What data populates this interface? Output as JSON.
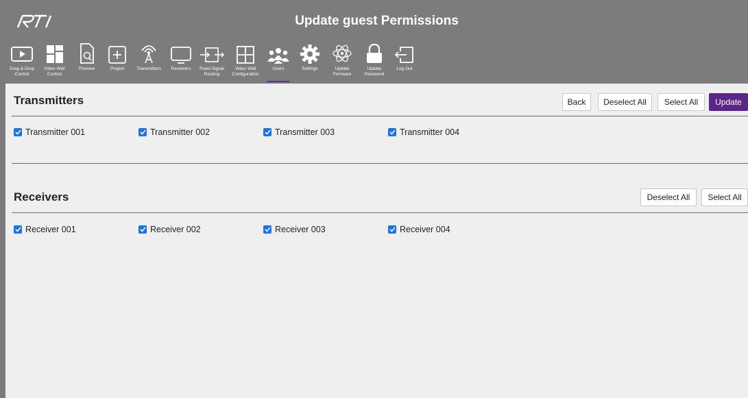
{
  "header": {
    "title": "Update guest Permissions",
    "logo_text": "RTI"
  },
  "nav": [
    {
      "label": "Drag & Drop\nControl",
      "icon": "play-screen-icon"
    },
    {
      "label": "Video Wall\nControl",
      "icon": "video-wall-tiles-icon"
    },
    {
      "label": "Preview",
      "icon": "document-search-icon"
    },
    {
      "label": "Project",
      "icon": "plus-box-icon"
    },
    {
      "label": "Transmitters",
      "icon": "broadcast-antenna-icon"
    },
    {
      "label": "Receivers",
      "icon": "monitor-icon"
    },
    {
      "label": "Fixed Signal\nRouting",
      "icon": "routing-arrows-icon"
    },
    {
      "label": "Video Wall\nConfiguration",
      "icon": "grid-icon"
    },
    {
      "label": "Users",
      "icon": "users-icon",
      "active": true
    },
    {
      "label": "Settings",
      "icon": "gear-icon"
    },
    {
      "label": "Update\nFirmware",
      "icon": "atom-icon"
    },
    {
      "label": "Update\nPassword",
      "icon": "lock-icon"
    },
    {
      "label": "Log Out",
      "icon": "logout-icon"
    }
  ],
  "transmitters": {
    "title": "Transmitters",
    "buttons": {
      "back": "Back",
      "deselect": "Deselect All",
      "select": "Select All",
      "update": "Update"
    },
    "items": [
      {
        "label": "Transmitter 001",
        "checked": true
      },
      {
        "label": "Transmitter 002",
        "checked": true
      },
      {
        "label": "Transmitter 003",
        "checked": true
      },
      {
        "label": "Transmitter 004",
        "checked": true
      }
    ]
  },
  "receivers": {
    "title": "Receivers",
    "buttons": {
      "deselect": "Deselect All",
      "select": "Select All"
    },
    "items": [
      {
        "label": "Receiver 001",
        "checked": true
      },
      {
        "label": "Receiver 002",
        "checked": true
      },
      {
        "label": "Receiver 003",
        "checked": true
      },
      {
        "label": "Receiver 004",
        "checked": true
      }
    ]
  },
  "colors": {
    "header_bg": "#7c7b7d",
    "accent_purple": "#5b2589",
    "checkbox_blue": "#1a73e8",
    "page_bg": "#efefef"
  }
}
